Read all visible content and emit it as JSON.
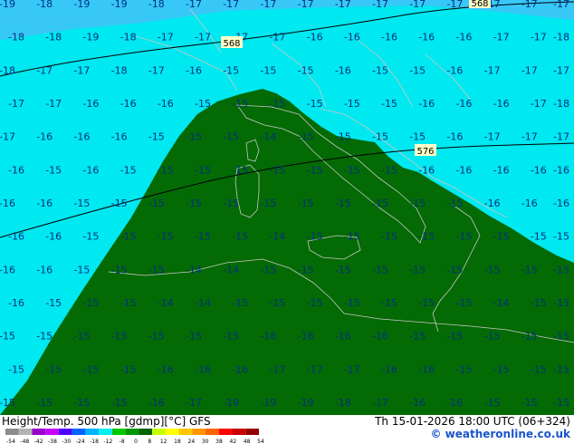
{
  "map": {
    "background_color": "#00e8f0",
    "cold_color": "#38c8f8",
    "warm_region_color": "#046a04",
    "contour_color": "#000000",
    "border_color": "#c8c8c8",
    "height_labels": [
      "568",
      "568",
      "576"
    ],
    "temperature_grid": [
      [
        "-19",
        "-18",
        "-19",
        "-19",
        "-18",
        "-17",
        "-17",
        "-17",
        "-17",
        "-17",
        "-17",
        "-17",
        "-17",
        "-17",
        "-17",
        "-17"
      ],
      [
        "-18",
        "-18",
        "-19",
        "-18",
        "-17",
        "-17",
        "-17",
        "-17",
        "-16",
        "-16",
        "-16",
        "-16",
        "-16",
        "-17",
        "-17",
        "-18"
      ],
      [
        "-18",
        "-17",
        "-17",
        "-18",
        "-17",
        "-16",
        "-15",
        "-15",
        "-15",
        "-16",
        "-15",
        "-15",
        "-16",
        "-17",
        "-17",
        "-17"
      ],
      [
        "-17",
        "-17",
        "-16",
        "-16",
        "-16",
        "-15",
        "-15",
        "-15",
        "-15",
        "-15",
        "-15",
        "-16",
        "-16",
        "-16",
        "-17",
        "-18"
      ],
      [
        "-17",
        "-16",
        "-16",
        "-16",
        "-15",
        "-15",
        "-15",
        "-14",
        "-15",
        "-15",
        "-15",
        "-15",
        "-16",
        "-17",
        "-17",
        "-17"
      ],
      [
        "-16",
        "-15",
        "-16",
        "-15",
        "-15",
        "-15",
        "-15",
        "-15",
        "-15",
        "-15",
        "-15",
        "-16",
        "-16",
        "-16",
        "-16",
        "-16"
      ],
      [
        "-16",
        "-16",
        "-15",
        "-15",
        "-15",
        "-15",
        "-15",
        "-15",
        "-15",
        "-15",
        "-15",
        "-15",
        "-15",
        "-16",
        "-16",
        "-16"
      ],
      [
        "-16",
        "-16",
        "-15",
        "-15",
        "-15",
        "-15",
        "-15",
        "-14",
        "-15",
        "-15",
        "-15",
        "-15",
        "-15",
        "-15",
        "-15",
        "-15"
      ],
      [
        "-16",
        "-16",
        "-15",
        "-15",
        "-15",
        "-14",
        "-14",
        "-15",
        "-15",
        "-15",
        "-15",
        "-15",
        "-15",
        "-15",
        "-15",
        "-15"
      ],
      [
        "-16",
        "-15",
        "-15",
        "-15",
        "-14",
        "-14",
        "-15",
        "-15",
        "-15",
        "-15",
        "-15",
        "-15",
        "-15",
        "-14",
        "-15",
        "-15"
      ],
      [
        "-15",
        "-15",
        "-15",
        "-15",
        "-15",
        "-15",
        "-15",
        "-16",
        "-16",
        "-16",
        "-16",
        "-15",
        "-15",
        "-15",
        "-15",
        "-15"
      ],
      [
        "-15",
        "-15",
        "-15",
        "-15",
        "-16",
        "-16",
        "-16",
        "-17",
        "-17",
        "-17",
        "-16",
        "-16",
        "-15",
        "-15",
        "-15",
        "-15"
      ],
      [
        "-15",
        "-15",
        "-15",
        "-15",
        "-16",
        "-17",
        "-19",
        "-19",
        "-19",
        "-18",
        "-17",
        "-16",
        "-16",
        "-15",
        "-15",
        "-15"
      ]
    ]
  },
  "footer": {
    "title": "Height/Temp. 500 hPa [gdmp][°C] GFS",
    "valid": "Th 15-01-2026 18:00 UTC (06+324)",
    "copyright": "© weatheronline.co.uk"
  },
  "colorbar": {
    "ticks": [
      "-54",
      "-48",
      "-42",
      "-38",
      "-30",
      "-24",
      "-18",
      "-12",
      "-8",
      "0",
      "8",
      "12",
      "18",
      "24",
      "30",
      "38",
      "42",
      "48",
      "54"
    ],
    "colors": [
      "#8c8c8c",
      "#b4b4b4",
      "#9600c8",
      "#c800ff",
      "#4b00ff",
      "#0064ff",
      "#00b4ff",
      "#00f0f0",
      "#00c800",
      "#009600",
      "#006400",
      "#c8ff00",
      "#ffff00",
      "#ffc800",
      "#ff9600",
      "#ff6400",
      "#ff0000",
      "#c80000",
      "#960000"
    ]
  }
}
